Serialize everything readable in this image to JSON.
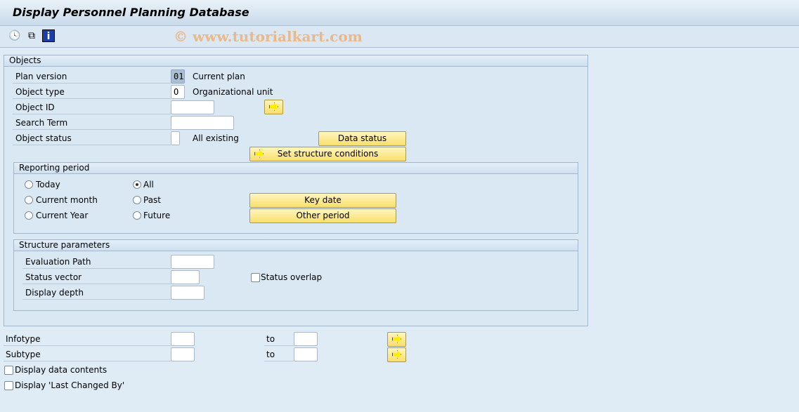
{
  "title": "Display Personnel Planning Database",
  "toolbar": {
    "icons": [
      "execute-clock-icon",
      "copy-icon",
      "info-icon"
    ]
  },
  "watermark": "© www.tutorialkart.com",
  "objects": {
    "header": "Objects",
    "plan_version": {
      "label": "Plan version",
      "value": "01",
      "desc": "Current plan"
    },
    "object_type": {
      "label": "Object type",
      "value": "O",
      "desc": "Organizational unit"
    },
    "object_id": {
      "label": "Object ID",
      "value": ""
    },
    "search_term": {
      "label": "Search Term",
      "value": ""
    },
    "object_status": {
      "label": "Object status",
      "value": "",
      "desc": "All existing"
    },
    "data_status_btn": "Data status",
    "set_structure_btn": "Set structure conditions"
  },
  "reporting": {
    "header": "Reporting period",
    "radios": [
      {
        "label": "Today",
        "selected": false
      },
      {
        "label": "Current month",
        "selected": false
      },
      {
        "label": "Current Year",
        "selected": false
      },
      {
        "label": "All",
        "selected": true
      },
      {
        "label": "Past",
        "selected": false
      },
      {
        "label": "Future",
        "selected": false
      }
    ],
    "key_date_btn": "Key date",
    "other_period_btn": "Other period"
  },
  "structure": {
    "header": "Structure parameters",
    "eval_path": {
      "label": "Evaluation Path",
      "value": ""
    },
    "status_vector": {
      "label": "Status vector",
      "value": ""
    },
    "display_depth": {
      "label": "Display depth",
      "value": ""
    },
    "status_overlap": {
      "label": "Status overlap",
      "checked": false
    }
  },
  "infotype": {
    "label": "Infotype",
    "to": "to",
    "from_value": "",
    "to_value": ""
  },
  "subtype": {
    "label": "Subtype",
    "to": "to",
    "from_value": "",
    "to_value": ""
  },
  "display_data": {
    "label": "Display data contents",
    "checked": false
  },
  "display_last_changed": {
    "label": "Display 'Last Changed By'",
    "checked": false
  }
}
